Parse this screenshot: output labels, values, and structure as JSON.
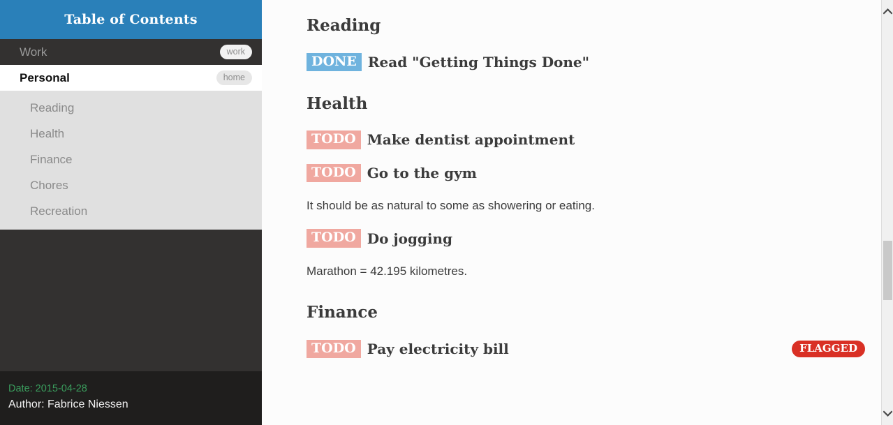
{
  "sidebar": {
    "header_title": "Table of Contents",
    "top_items": [
      {
        "label": "Work",
        "tag": "work",
        "active": false
      },
      {
        "label": "Personal",
        "tag": "home",
        "active": true
      }
    ],
    "sub_items": [
      {
        "label": "Reading"
      },
      {
        "label": "Health"
      },
      {
        "label": "Finance"
      },
      {
        "label": "Chores"
      },
      {
        "label": "Recreation"
      }
    ],
    "footer": {
      "date": "Date: 2015-04-28",
      "author": "Author: Fabrice Niessen"
    }
  },
  "content": {
    "blocks": [
      {
        "type": "heading",
        "text": "Reading"
      },
      {
        "type": "task",
        "keyword": "DONE",
        "title": "Read \"Getting Things Done\""
      },
      {
        "type": "heading",
        "text": "Health"
      },
      {
        "type": "task",
        "keyword": "TODO",
        "title": "Make dentist appointment"
      },
      {
        "type": "task",
        "keyword": "TODO",
        "title": "Go to the gym"
      },
      {
        "type": "paragraph",
        "text": "It should be as natural to some as showering or eating."
      },
      {
        "type": "task",
        "keyword": "TODO",
        "title": "Do jogging"
      },
      {
        "type": "paragraph",
        "text": "Marathon = 42.195 kilometres."
      },
      {
        "type": "heading",
        "text": "Finance"
      },
      {
        "type": "task",
        "keyword": "TODO",
        "title": "Pay electricity bill",
        "flag": "FLAGGED"
      }
    ]
  },
  "scrollbar": {
    "up_icon": "chevron-up-icon",
    "down_icon": "chevron-down-icon"
  },
  "colors": {
    "header_blue": "#2a80b9",
    "sidebar_dark": "#333130",
    "sidebar_footer": "#1f1e1d",
    "sublist_gray": "#e0e0e0",
    "todo_badge": "#f0a8a0",
    "done_badge": "#6fb3de",
    "flag_red": "#d93025",
    "date_green": "#3a9d5d",
    "content_bg": "#fcfcfc"
  }
}
